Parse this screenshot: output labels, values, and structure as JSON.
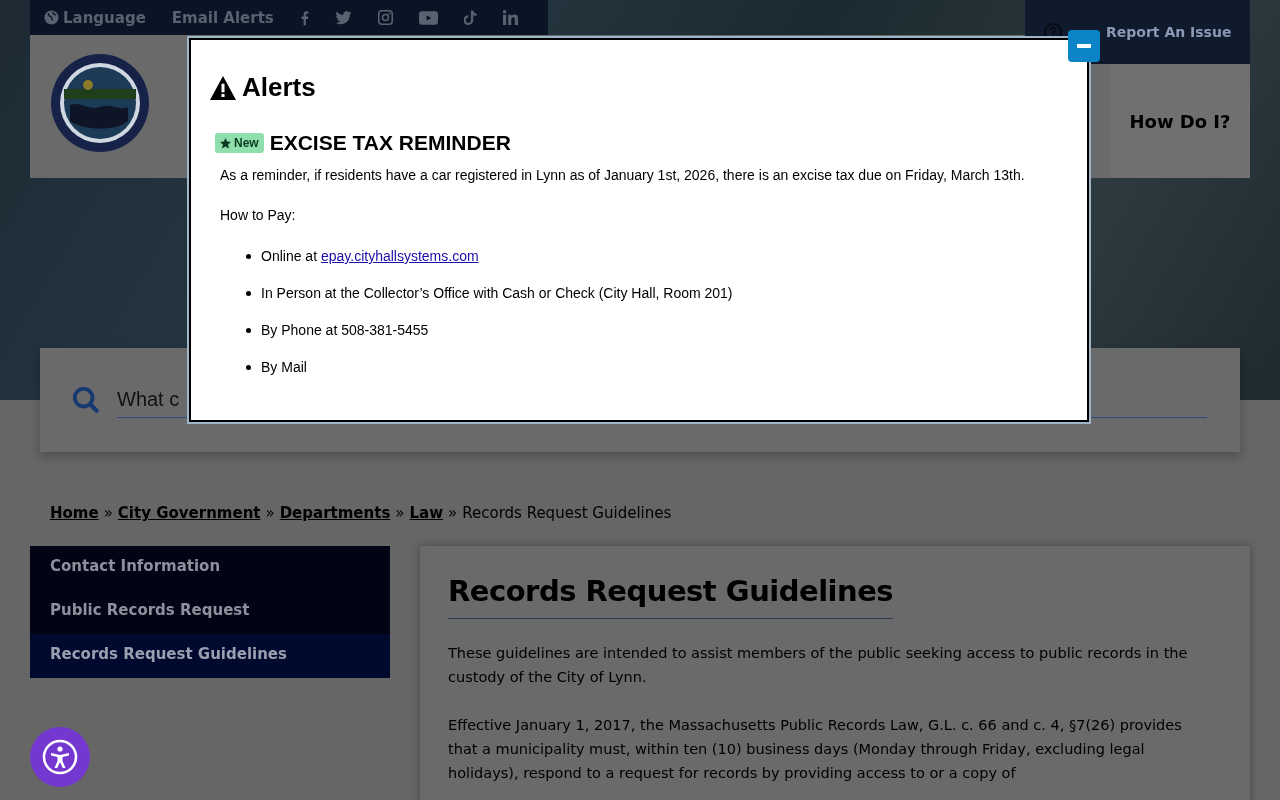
{
  "utility_bar": {
    "items": [
      {
        "kind": "language",
        "label": "Language"
      },
      {
        "kind": "link",
        "label": "Email Alerts"
      }
    ]
  },
  "report_button": {
    "label": "Report An Issue"
  },
  "header": {
    "nav_item": "How Do I?"
  },
  "search": {
    "placeholder": "What c"
  },
  "breadcrumb": {
    "links": [
      "Home",
      "City Government",
      "Departments",
      "Law"
    ],
    "separator": "»",
    "current": "Records Request Guidelines"
  },
  "sidebar": {
    "items": [
      {
        "label": "Contact Information",
        "selected": false
      },
      {
        "label": "Public Records Request",
        "selected": false
      },
      {
        "label": "Records Request Guidelines",
        "selected": true
      }
    ]
  },
  "content": {
    "title": "Records Request Guidelines",
    "paragraphs": [
      "These guidelines are intended to assist members of the public seeking access to public records in the custody of the City of Lynn.",
      "Effective January 1, 2017, the Massachusetts Public Records Law, G.L. c. 66 and c. 4, §7(26) provides that a municipality must, within ten (10) business days (Monday through Friday, excluding legal holidays), respond to a request for records by providing access to or a copy of"
    ]
  },
  "alert_modal": {
    "title": "Alerts",
    "alerts": [
      {
        "badge": "New",
        "title": "EXCISE TAX REMINDER",
        "intro": "As a reminder, if residents have a car registered in Lynn as of January 1st, 2026, there is an excise tax due on Friday, March 13th.",
        "subheading": "How to Pay:",
        "methods": [
          {
            "text": "Online at ",
            "link": "epay.cityhallsystems.com"
          },
          {
            "text": "In Person at the Collector’s Office with Cash or Check (City Hall, Room 201)"
          },
          {
            "text": "By Phone at 508-381-5455"
          },
          {
            "text": "By Mail"
          }
        ]
      }
    ]
  }
}
